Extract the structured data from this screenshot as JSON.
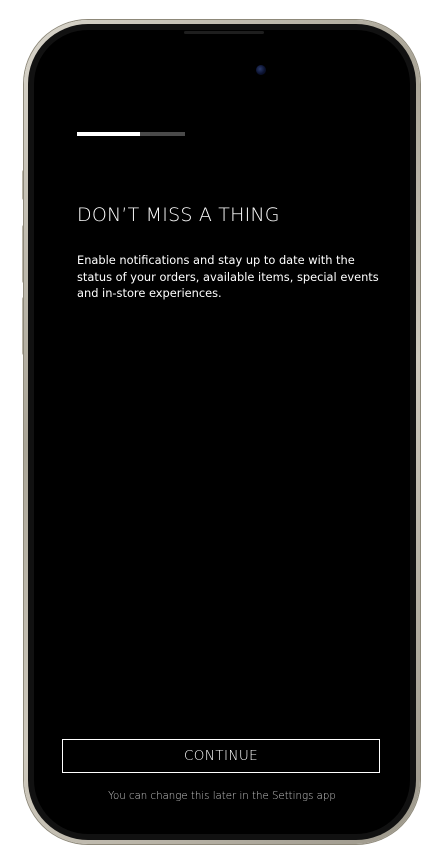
{
  "onboarding": {
    "progress": 0.58,
    "title": "DON’T MISS A THING",
    "description": "Enable notifications and stay up to date with the status of your orders, available items, special events and in-store experiences.",
    "continue_label": "CONTINUE",
    "footnote": "You can change this later in the Settings app"
  },
  "colors": {
    "screen_background": "#000000",
    "text": "#ffffff",
    "progress_fill": "#ffffff",
    "progress_track": "#4a4a4a",
    "footnote": "#c9c9c9"
  }
}
